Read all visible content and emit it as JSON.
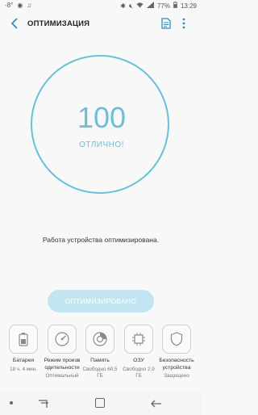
{
  "status_bar": {
    "left": "-8°",
    "battery": "77%",
    "time": "13:29"
  },
  "appbar": {
    "title": "ОПТИМИЗАЦИЯ"
  },
  "score": {
    "value": "100",
    "label": "ОТЛИЧНО!"
  },
  "message": "Работа устройства оптимизирована.",
  "optimize_button": "ОПТИМИЗИРОВАНО",
  "tiles": [
    {
      "name": "Батарея",
      "value": "18 ч. 4 мин.",
      "icon": "battery-icon"
    },
    {
      "name": "Режим производительности",
      "value": "Оптимальный",
      "icon": "speedometer-icon"
    },
    {
      "name": "Память",
      "value": "Свободно 60,5 ГБ",
      "icon": "storage-icon"
    },
    {
      "name": "ОЗУ",
      "value": "Свободно 2,9 ГБ",
      "icon": "chip-icon"
    },
    {
      "name": "Безопасность устройства",
      "value": "Защищено",
      "icon": "shield-icon"
    }
  ],
  "accent_color": "#67c2d8",
  "button_color": "#c2e6f1"
}
